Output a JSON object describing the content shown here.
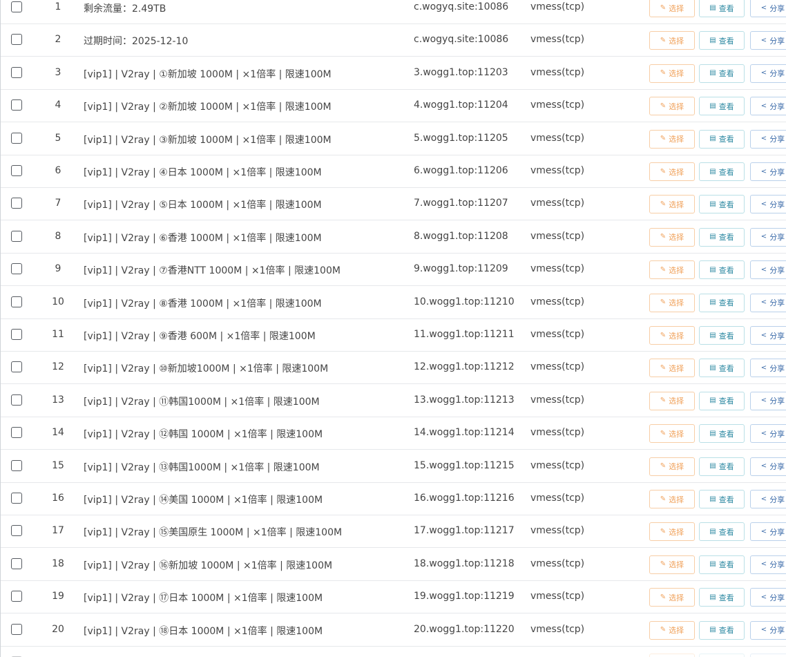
{
  "buttons": {
    "select": "选择",
    "view": "查看",
    "share": "分享"
  },
  "icons": {
    "select": "pencil-icon",
    "view": "document-icon",
    "share": "share-icon"
  },
  "colors": {
    "select_accent": "#f0a15a",
    "view_accent": "#2f8aa3",
    "share_accent": "#3a6aa8"
  },
  "rows": [
    {
      "index": "1",
      "name": "剩余流量：2.49TB",
      "address": "c.wogyq.site:10086",
      "protocol": "vmess(tcp)"
    },
    {
      "index": "2",
      "name": "过期时间：2025-12-10",
      "address": "c.wogyq.site:10086",
      "protocol": "vmess(tcp)"
    },
    {
      "index": "3",
      "name": "[vip1] | V2ray | ①新加坡 1000M | ×1倍率 | 限速100M",
      "address": "3.wogg1.top:11203",
      "protocol": "vmess(tcp)"
    },
    {
      "index": "4",
      "name": "[vip1] | V2ray | ②新加坡 1000M | ×1倍率 | 限速100M",
      "address": "4.wogg1.top:11204",
      "protocol": "vmess(tcp)"
    },
    {
      "index": "5",
      "name": "[vip1] | V2ray | ③新加坡 1000M | ×1倍率 | 限速100M",
      "address": "5.wogg1.top:11205",
      "protocol": "vmess(tcp)"
    },
    {
      "index": "6",
      "name": "[vip1] | V2ray | ④日本 1000M | ×1倍率 | 限速100M",
      "address": "6.wogg1.top:11206",
      "protocol": "vmess(tcp)"
    },
    {
      "index": "7",
      "name": "[vip1] | V2ray | ⑤日本 1000M | ×1倍率 | 限速100M",
      "address": "7.wogg1.top:11207",
      "protocol": "vmess(tcp)"
    },
    {
      "index": "8",
      "name": "[vip1] | V2ray | ⑥香港 1000M | ×1倍率 | 限速100M",
      "address": "8.wogg1.top:11208",
      "protocol": "vmess(tcp)"
    },
    {
      "index": "9",
      "name": "[vip1] | V2ray | ⑦香港NTT 1000M | ×1倍率 | 限速100M",
      "address": "9.wogg1.top:11209",
      "protocol": "vmess(tcp)"
    },
    {
      "index": "10",
      "name": "[vip1] | V2ray | ⑧香港 1000M | ×1倍率 | 限速100M",
      "address": "10.wogg1.top:11210",
      "protocol": "vmess(tcp)"
    },
    {
      "index": "11",
      "name": "[vip1] | V2ray | ⑨香港 600M | ×1倍率 | 限速100M",
      "address": "11.wogg1.top:11211",
      "protocol": "vmess(tcp)"
    },
    {
      "index": "12",
      "name": "[vip1] | V2ray | ⑩新加坡1000M | ×1倍率 | 限速100M",
      "address": "12.wogg1.top:11212",
      "protocol": "vmess(tcp)"
    },
    {
      "index": "13",
      "name": "[vip1] | V2ray | ⑪韩国1000M | ×1倍率 | 限速100M",
      "address": "13.wogg1.top:11213",
      "protocol": "vmess(tcp)"
    },
    {
      "index": "14",
      "name": "[vip1] | V2ray | ⑫韩国 1000M | ×1倍率 | 限速100M",
      "address": "14.wogg1.top:11214",
      "protocol": "vmess(tcp)"
    },
    {
      "index": "15",
      "name": "[vip1] | V2ray | ⑬韩国1000M | ×1倍率 | 限速100M",
      "address": "15.wogg1.top:11215",
      "protocol": "vmess(tcp)"
    },
    {
      "index": "16",
      "name": "[vip1] | V2ray | ⑭美国 1000M | ×1倍率 | 限速100M",
      "address": "16.wogg1.top:11216",
      "protocol": "vmess(tcp)"
    },
    {
      "index": "17",
      "name": "[vip1] | V2ray | ⑮美国原生 1000M | ×1倍率 | 限速100M",
      "address": "17.wogg1.top:11217",
      "protocol": "vmess(tcp)"
    },
    {
      "index": "18",
      "name": "[vip1] | V2ray | ⑯新加坡 1000M | ×1倍率 | 限速100M",
      "address": "18.wogg1.top:11218",
      "protocol": "vmess(tcp)"
    },
    {
      "index": "19",
      "name": "[vip1] | V2ray | ⑰日本 1000M | ×1倍率 | 限速100M",
      "address": "19.wogg1.top:11219",
      "protocol": "vmess(tcp)"
    },
    {
      "index": "20",
      "name": "[vip1] | V2ray | ⑱日本 1000M | ×1倍率 | 限速100M",
      "address": "20.wogg1.top:11220",
      "protocol": "vmess(tcp)"
    }
  ]
}
